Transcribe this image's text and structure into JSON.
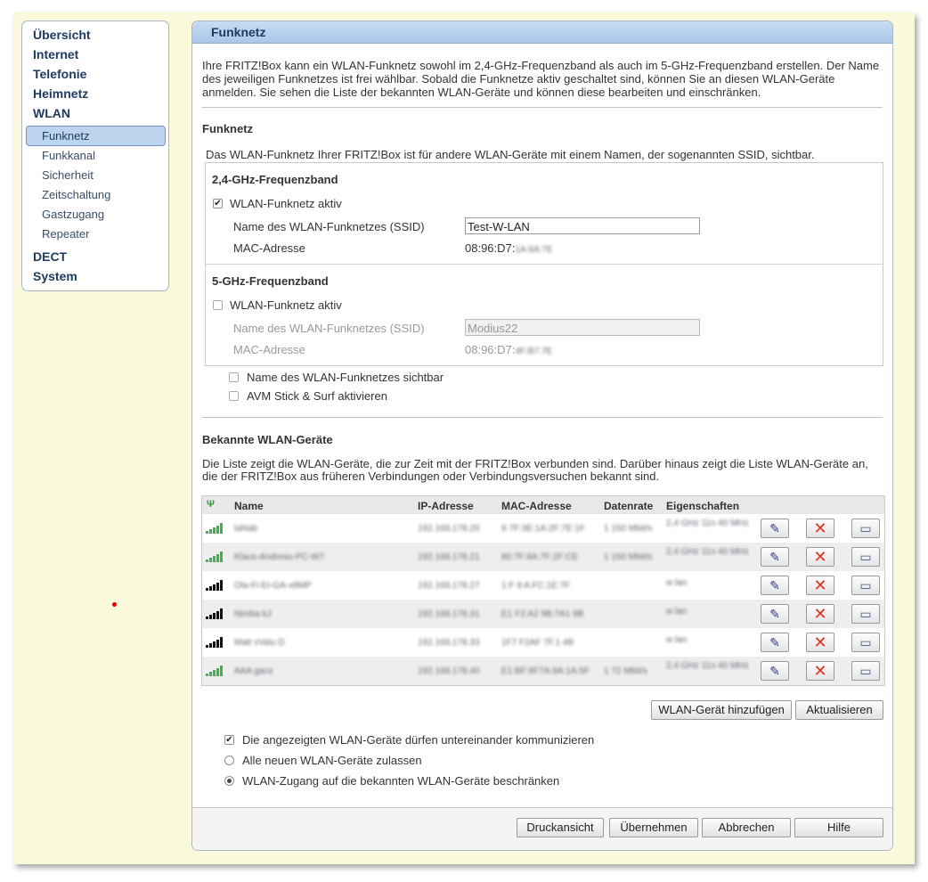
{
  "nav": {
    "main": [
      "Übersicht",
      "Internet",
      "Telefonie",
      "Heimnetz",
      "WLAN"
    ],
    "wlan_sub": [
      "Funknetz",
      "Funkkanal",
      "Sicherheit",
      "Zeitschaltung",
      "Gastzugang",
      "Repeater"
    ],
    "bottom": [
      "DECT",
      "System"
    ]
  },
  "panel": {
    "title": "Funknetz",
    "intro_1": "Ihre FRITZ!Box kann ein WLAN-Funknetz sowohl im 2,4-GHz-Frequenzband als auch im 5-GHz-Frequenzband erstellen. Der Name",
    "intro_2": "des jeweiligen Funknetzes ist frei wählbar. Sobald die Funknetze aktiv geschaltet sind, können Sie an diesen WLAN-Geräte",
    "intro_3": "anmelden. Sie sehen die Liste der bekannten WLAN-Geräte und können diese bearbeiten und einschränken."
  },
  "funknetz": {
    "heading": "Funknetz",
    "desc": "Das WLAN-Funknetz Ihrer FRITZ!Box ist für andere WLAN-Geräte mit einem Namen, der sogenannten SSID, sichtbar.",
    "band24": {
      "heading": "2,4-GHz-Frequenzband",
      "active_label": "WLAN-Funknetz aktiv",
      "active": true,
      "ssid_label": "Name des WLAN-Funknetzes (SSID)",
      "ssid": "Test-W-LAN",
      "mac_label": "MAC-Adresse",
      "mac": "08:96:D7:",
      "mac_hidden": "1A:6A:7E"
    },
    "band5": {
      "heading": "5-GHz-Frequenzband",
      "active_label": "WLAN-Funknetz aktiv",
      "active": false,
      "ssid_label": "Name des WLAN-Funknetzes (SSID)",
      "ssid": "Modius22",
      "mac_label": "MAC-Adresse",
      "mac": "08:96:D7:",
      "mac_hidden": "4F:B7:7E"
    },
    "visible_label": "Name des WLAN-Funknetzes sichtbar",
    "stick_label": "AVM Stick & Surf aktivieren"
  },
  "devices": {
    "heading": "Bekannte WLAN-Geräte",
    "desc_1": "Die Liste zeigt die WLAN-Geräte, die zur Zeit mit der FRITZ!Box verbunden sind. Darüber hinaus zeigt die Liste WLAN-Geräte an,",
    "desc_2": "die der FRITZ!Box aus früheren Verbindungen oder Verbindungsversuchen bekannt sind.",
    "columns": [
      "Name",
      "IP-Adresse",
      "MAC-Adresse",
      "Datenrate",
      "Eigenschaften"
    ],
    "rows": [
      {
        "name": "laNab",
        "ip": "192.168.178.20",
        "mac": "9 7F:3E:1A:2F:7E:1F",
        "rate": "1 150 Mbit/s",
        "props": "2,4 GHz 11n 40 MHz",
        "signal": "green"
      },
      {
        "name": "Klaus-Andreas-PC-W7",
        "ip": "192.168.178.21",
        "mac": "80:7F:8A:7F:2F:CE",
        "rate": "1 150 Mbit/s",
        "props": "2,4 GHz 11n 40 MHz",
        "signal": "green"
      },
      {
        "name": "Ola-Fi-EI-GA-x8MP",
        "ip": "192.168.178.27",
        "mac": "1:F 9 A:FC:1E:7F",
        "rate": "",
        "props": "w lan",
        "signal": "black"
      },
      {
        "name": "Nimba kJ",
        "ip": "192.168.178.31",
        "mac": "E1 F2:A2 9B:7A1 9B",
        "rate": "",
        "props": "w lan",
        "signal": "black"
      },
      {
        "name": "Matt vValu D",
        "ip": "192.168.178.33",
        "mac": "1F7 F2AF 7F.1 4B",
        "rate": "",
        "props": "w lan",
        "signal": "black"
      },
      {
        "name": "AAA ganz",
        "ip": "192.168.178.40",
        "mac": "E1:BF:8F7A:9A:1A:5F",
        "rate": "1 72 Mbit/s",
        "props": "2,4 GHz 11n 40 MHz",
        "signal": "green"
      }
    ],
    "add_button": "WLAN-Gerät hinzufügen",
    "refresh_button": "Aktualisieren"
  },
  "options": {
    "communicate_label": "Die angezeigten WLAN-Geräte dürfen untereinander kommunizieren",
    "communicate": true,
    "allow_all_label": "Alle neuen WLAN-Geräte zulassen",
    "restrict_label": "WLAN-Zugang auf die bekannten WLAN-Geräte beschränken",
    "selected": "restrict"
  },
  "footer": {
    "print": "Druckansicht",
    "apply": "Übernehmen",
    "cancel": "Abbrechen",
    "help": "Hilfe"
  },
  "colors": {
    "accent": "#1d3a5f",
    "frame": "#faf9db",
    "delete": "#e03020",
    "signal": "#39b54a"
  }
}
